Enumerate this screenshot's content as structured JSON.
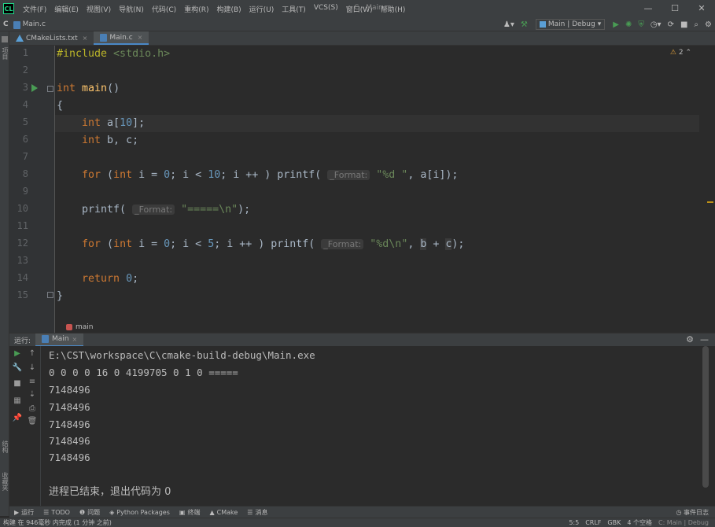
{
  "app": {
    "logo": "CL",
    "window_title": "C - Main.c",
    "menu": [
      "文件(F)",
      "编辑(E)",
      "视图(V)",
      "导航(N)",
      "代码(C)",
      "重构(R)",
      "构建(B)",
      "运行(U)",
      "工具(T)",
      "VCS(S)",
      "窗口(W)",
      "帮助(H)"
    ],
    "controls": {
      "minimize": "—",
      "maximize": "☐",
      "close": "✕"
    }
  },
  "navbar": {
    "project": "C",
    "file": "Main.c",
    "run_config": "Main | Debug"
  },
  "tabs": [
    {
      "label": "CMakeLists.txt",
      "close": "×"
    },
    {
      "label": "Main.c",
      "close": "×"
    }
  ],
  "left_strip": {
    "project_label": "项目",
    "structure_label": "结构",
    "favorites_label": "收藏夹"
  },
  "editor": {
    "line_numbers": [
      "1",
      "2",
      "3",
      "4",
      "5",
      "6",
      "7",
      "8",
      "9",
      "10",
      "11",
      "12",
      "13",
      "14",
      "15"
    ],
    "lines": {
      "l1_pp": "#include",
      "l1_hdr": " <stdio.h>",
      "l3_kw": "int",
      "l3_fn": " main",
      "l3_rest": "()",
      "l4": "{",
      "l5_kw": "    int",
      "l5_a": " a[",
      "l5_num": "10",
      "l5_b": "];",
      "l6_kw": "    int",
      "l6_rest": " b, c;",
      "l8_kw": "    for",
      "l8_a": " (",
      "l8_kw2": "int",
      "l8_b": " i = ",
      "l8_num1": "0",
      "l8_c": "; i < ",
      "l8_num2": "10",
      "l8_d": "; i ++ ) printf( ",
      "l8_hint": "_Format:",
      "l8_str": " \"%d \"",
      "l8_e": ", a[i]);",
      "l10_a": "    printf( ",
      "l10_hint": "_Format:",
      "l10_str": " \"=====\\n\"",
      "l10_b": ");",
      "l12_kw": "    for",
      "l12_a": " (",
      "l12_kw2": "int",
      "l12_b": " i = ",
      "l12_num1": "0",
      "l12_c": "; i < ",
      "l12_num2": "5",
      "l12_d": "; i ++ ) printf( ",
      "l12_hint": "_Format:",
      "l12_str": " \"%d\\n\"",
      "l12_e": ", ",
      "l12_b_var": "b",
      "l12_f": " + ",
      "l12_c_var": "c",
      "l12_g": ");",
      "l14_kw": "    return",
      "l14_num": " 0",
      "l14_rest": ";",
      "l15": "}"
    },
    "warnings": "2",
    "breadcrumb": "main"
  },
  "run_panel": {
    "label": "运行:",
    "tab": "Main",
    "tab_close": "×",
    "console": [
      "E:\\CST\\workspace\\C\\cmake-build-debug\\Main.exe",
      "0 0 0 0 16 0 4199705 0 1 0 =====",
      "7148496",
      "7148496",
      "7148496",
      "7148496",
      "7148496",
      "",
      "进程已结束，退出代码为 0"
    ]
  },
  "bottom_tabs": [
    "运行",
    "TODO",
    "问题",
    "Python Packages",
    "终端",
    "CMake",
    "消息"
  ],
  "event_log": "事件日志",
  "status": {
    "left": "构建 在 946毫秒 内完成 (1 分钟 之前)",
    "position": "5:5",
    "line_sep": "CRLF",
    "encoding": "GBK",
    "indent": "4 个空格",
    "context": "C: Main | Debug"
  }
}
